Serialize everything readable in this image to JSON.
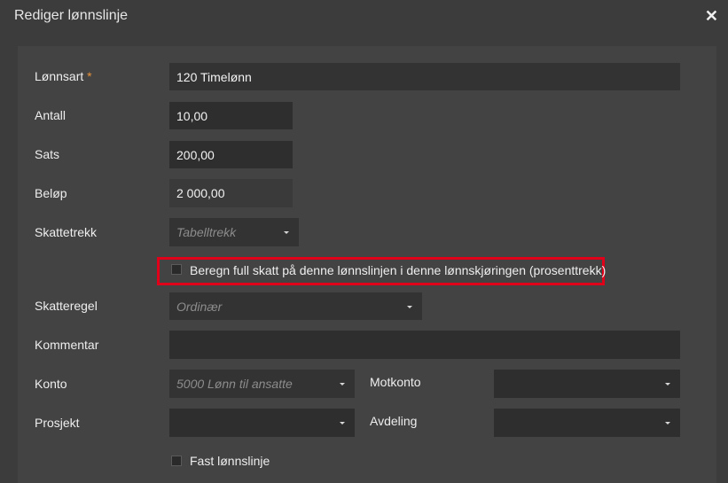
{
  "dialog": {
    "title": "Rediger lønnslinje",
    "close_glyph": "✕"
  },
  "fields": {
    "lonnsart": {
      "label": "Lønnsart",
      "required_mark": "*",
      "value": "120 Timelønn"
    },
    "antall": {
      "label": "Antall",
      "value": "10,00"
    },
    "sats": {
      "label": "Sats",
      "value": "200,00"
    },
    "belop": {
      "label": "Beløp",
      "value": "2 000,00"
    },
    "skattetrekk": {
      "label": "Skattetrekk",
      "placeholder": "Tabelltrekk"
    },
    "full_skatt": {
      "label": "Beregn full skatt på denne lønnslinjen i denne lønnskjøringen (prosenttrekk)",
      "checked": false
    },
    "skatteregel": {
      "label": "Skatteregel",
      "placeholder": "Ordinær"
    },
    "kommentar": {
      "label": "Kommentar",
      "value": ""
    },
    "konto": {
      "label": "Konto",
      "placeholder": "5000 Lønn til ansatte"
    },
    "motkonto": {
      "label": "Motkonto",
      "value": ""
    },
    "prosjekt": {
      "label": "Prosjekt",
      "value": ""
    },
    "avdeling": {
      "label": "Avdeling",
      "value": ""
    },
    "fast": {
      "label": "Fast lønnslinje",
      "checked": false
    }
  },
  "colors": {
    "highlight": "#e0001a",
    "required": "#e8923a"
  }
}
